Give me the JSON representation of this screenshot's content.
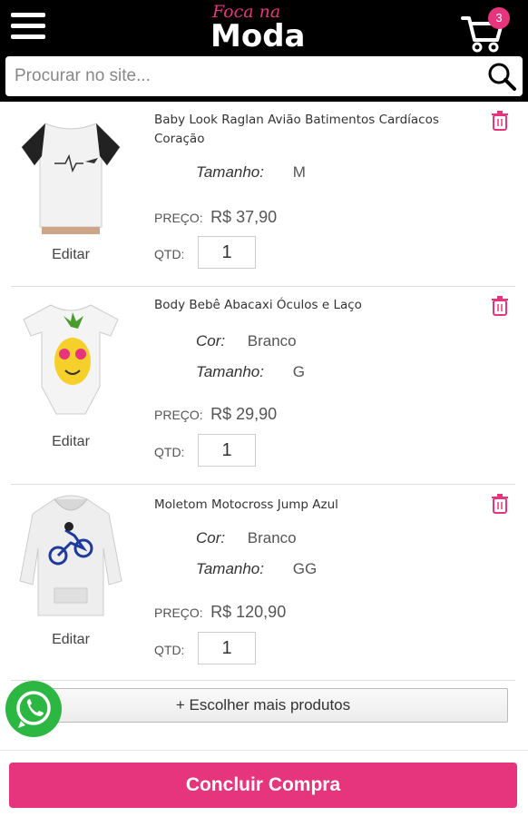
{
  "header": {
    "logo_top": "Foca na",
    "logo_main": "Moda",
    "cart_count": "3",
    "search_placeholder": "Procurar no site..."
  },
  "items": [
    {
      "title": "Baby Look Raglan Avião Batimentos Cardíacos Coração",
      "attrs": [
        {
          "label": "Tamanho:",
          "value": "M"
        }
      ],
      "price_label": "PREÇO:",
      "price": "R$ 37,90",
      "qty_label": "QTD:",
      "qty": "1",
      "edit": "Editar"
    },
    {
      "title": "Body Bebê Abacaxi Óculos e Laço",
      "attrs": [
        {
          "label": "Cor:",
          "value": "Branco"
        },
        {
          "label": "Tamanho:",
          "value": "G"
        }
      ],
      "price_label": "PREÇO:",
      "price": "R$ 29,90",
      "qty_label": "QTD:",
      "qty": "1",
      "edit": "Editar"
    },
    {
      "title": "Moletom Motocross Jump Azul",
      "attrs": [
        {
          "label": "Cor:",
          "value": "Branco"
        },
        {
          "label": "Tamanho:",
          "value": "GG"
        }
      ],
      "price_label": "PREÇO:",
      "price": "R$ 120,90",
      "qty_label": "QTD:",
      "qty": "1",
      "edit": "Editar"
    }
  ],
  "more_products": "+ Escolher mais produtos",
  "checkout": "Concluir Compra",
  "colors": {
    "accent": "#e6357d",
    "header_bg": "#000000",
    "whatsapp": "#2cb742"
  }
}
